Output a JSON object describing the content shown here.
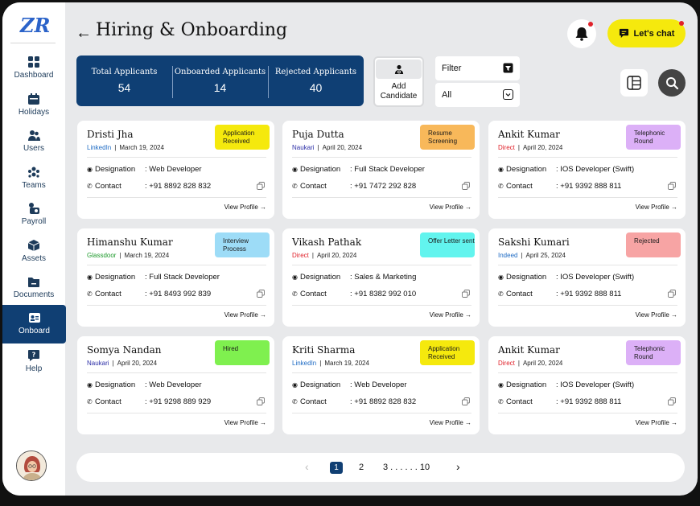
{
  "app": {
    "logo_text": "ZR"
  },
  "sidebar": {
    "items": [
      {
        "label": "Dashboard",
        "icon": "grid-icon"
      },
      {
        "label": "Holidays",
        "icon": "calendar-icon"
      },
      {
        "label": "Users",
        "icon": "users-icon"
      },
      {
        "label": "Teams",
        "icon": "teams-icon"
      },
      {
        "label": "Payroll",
        "icon": "payroll-icon"
      },
      {
        "label": "Assets",
        "icon": "box-icon"
      },
      {
        "label": "Documents",
        "icon": "folder-icon"
      },
      {
        "label": "Onboard",
        "icon": "id-card-icon",
        "active": true
      },
      {
        "label": "Help",
        "icon": "help-icon"
      }
    ]
  },
  "header": {
    "title": "Hiring & Onboarding",
    "chat_label": "Let's chat"
  },
  "stats": [
    {
      "label": "Total Applicants",
      "value": "54"
    },
    {
      "label": "Onboarded Applicants",
      "value": "14"
    },
    {
      "label": "Rejected Applicants",
      "value": "40"
    }
  ],
  "toolbar": {
    "add_label_1": "Add",
    "add_label_2": "Candidate",
    "filter_label": "Filter",
    "select_value": "All"
  },
  "labels": {
    "designation": "Designation",
    "contact": "Contact",
    "view_profile": "View Profile  →"
  },
  "colors": {
    "brand": "#103f73",
    "accent": "#f5e90d",
    "linkedin": "#1e6bc4",
    "naukari": "#2d2fa7",
    "direct": "#e0212a",
    "glassdoor": "#1e9a2c",
    "indeed": "#1e6bc4"
  },
  "cards": [
    {
      "name": "Dristi Jha",
      "source": "LinkedIn",
      "source_color": "#1e6bc4",
      "date": "March 19, 2024",
      "status": "Application Received",
      "status_color": "#f5e90d",
      "designation": ": Web Developer",
      "contact": ": +91 8892 828 832"
    },
    {
      "name": "Puja Dutta",
      "source": "Naukari",
      "source_color": "#2d2fa7",
      "date": "April 20, 2024",
      "status": "Resume Screening",
      "status_color": "#f8b85a",
      "designation": ": Full Stack Developer",
      "contact": ": +91 7472 292 828"
    },
    {
      "name": "Ankit Kumar",
      "source": "Direct",
      "source_color": "#e0212a",
      "date": "April 20, 2024",
      "status": "Telephonic Round",
      "status_color": "#dcb0f7",
      "designation": ": IOS Developer (Swift)",
      "contact": ": +91 9392 888 811"
    },
    {
      "name": "Himanshu Kumar",
      "source": "Glassdoor",
      "source_color": "#1e9a2c",
      "date": "March 19, 2024",
      "status": "Interview Process",
      "status_color": "#9ddcf7",
      "designation": ": Full Stack Developer",
      "contact": ": +91 8493 992 839"
    },
    {
      "name": "Vikash Pathak",
      "source": "Direct",
      "source_color": "#e0212a",
      "date": "April 20, 2024",
      "status": "Offer Letter sent",
      "status_color": "#62f4ee",
      "designation": ": Sales & Marketing",
      "contact": ": +91 8382 992 010"
    },
    {
      "name": "Sakshi Kumari",
      "source": "Indeed",
      "source_color": "#1e6bc4",
      "date": "April 25, 2024",
      "status": "Rejected",
      "status_color": "#f7a4a4",
      "designation": ": IOS Developer (Swift)",
      "contact": ": +91 9392 888 811"
    },
    {
      "name": "Somya Nandan",
      "source": "Naukari",
      "source_color": "#2d2fa7",
      "date": "April 20, 2024",
      "status": "Hired",
      "status_color": "#7ff04f",
      "designation": ": Web Developer",
      "contact": ": +91 9298 889 929"
    },
    {
      "name": "Kriti Sharma",
      "source": "LinkedIn",
      "source_color": "#1e6bc4",
      "date": "March 19, 2024",
      "status": "Application Received",
      "status_color": "#f5e90d",
      "designation": ": Web Developer",
      "contact": ": +91 8892 828 832"
    },
    {
      "name": "Ankit Kumar",
      "source": "Direct",
      "source_color": "#e0212a",
      "date": "April 20, 2024",
      "status": "Telephonic Round",
      "status_color": "#dcb0f7",
      "designation": ": IOS Developer (Swift)",
      "contact": ": +91 9392 888 811"
    }
  ],
  "pagination": {
    "prev": "‹",
    "page1": "1",
    "page2": "2",
    "ellipsis": "3 . . . . . .  10",
    "next": "›"
  }
}
